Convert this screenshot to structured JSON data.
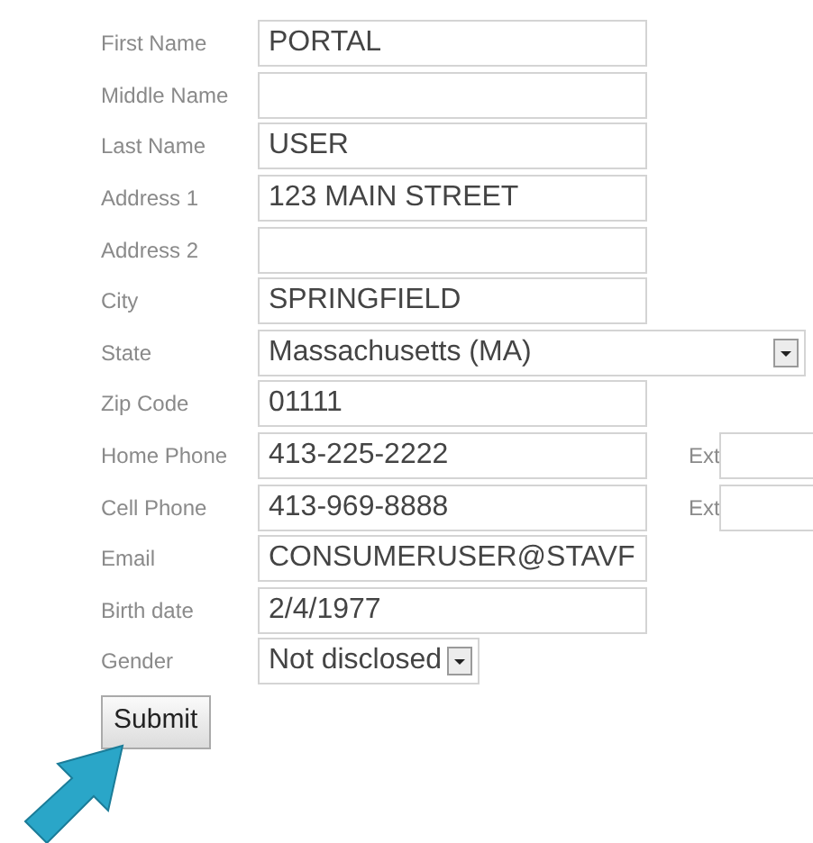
{
  "form": {
    "fields": [
      {
        "label": "First Name",
        "kind": "text",
        "value": "PORTAL"
      },
      {
        "label": "Middle Name",
        "kind": "text"
      },
      {
        "label": "Last Name",
        "kind": "text",
        "value": "USER"
      },
      {
        "label": "Address 1",
        "kind": "text",
        "value": "123 MAIN STREET"
      },
      {
        "label": "Address 2",
        "kind": "text"
      },
      {
        "label": "City",
        "kind": "text",
        "value": "SPRINGFIELD"
      },
      {
        "label": "State",
        "kind": "select",
        "value": "Massachusetts (MA)",
        "wide": true
      },
      {
        "label": "Zip Code",
        "kind": "text",
        "value": "01111"
      },
      {
        "label": "Home Phone",
        "kind": "text",
        "value": "413-225-2222",
        "ext": {
          "label": "Ext"
        }
      },
      {
        "label": "Cell Phone",
        "kind": "text",
        "value": "413-969-8888",
        "ext": {
          "label": "Ext"
        }
      },
      {
        "label": "Email",
        "kind": "text",
        "value": "CONSUMERUSER@STAVF"
      },
      {
        "label": "Birth date",
        "kind": "text",
        "value": "2/4/1977"
      },
      {
        "label": "Gender",
        "kind": "select",
        "value": "Not disclosed"
      }
    ],
    "submit": "Submit"
  }
}
